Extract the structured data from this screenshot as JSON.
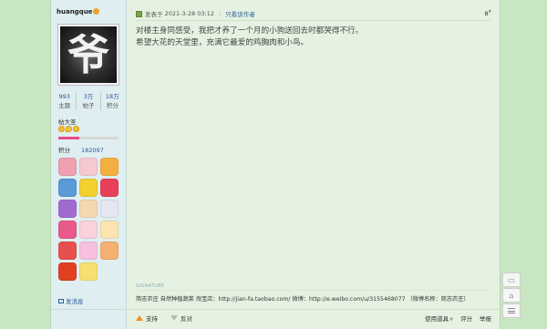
{
  "user": {
    "name": "huangque",
    "avatar_char": "爷",
    "stats": [
      {
        "value": "993",
        "label": "主题"
      },
      {
        "value": "3万",
        "label": "帖子"
      },
      {
        "value": "18万",
        "label": "积分"
      }
    ],
    "rank": "帖大圣",
    "level_progress": 0.35,
    "points_label": "积分",
    "points_value": "182097",
    "medals": [
      "#f0a0b0",
      "#f6c8d0",
      "#f3b040",
      "#5a9ad6",
      "#f2d030",
      "#e8405a",
      "#a06ad0",
      "#f4d9b0",
      "#e6e6f0",
      "#e85a8a",
      "#f9d2dc",
      "#fbe4b0",
      "#e85050",
      "#f7c0e0",
      "#f4b070",
      "#e04020",
      "#f8e070"
    ],
    "message_label": "发消息"
  },
  "post": {
    "posted_prefix": "发表于",
    "posted_time": "2021-3-28 03:12",
    "only_author": "只看该作者",
    "floor": "8",
    "floor_suffix": "#",
    "content_lines": [
      "对楼主身同感受，我把才养了一个月的小狗送回去时都哭得不行。",
      "希望大花的天堂里，充满它最爱的鸡胸肉和小鸟。"
    ],
    "signature_label": "SIGNATURE",
    "signature": "简志农庄 自然种植蔬菜 淘宝店：http://jian-fa.taobao.com/ 微博：http://e.weibo.com/u/3155468077 （微博名称：简志农庄）"
  },
  "actions": {
    "support": "支持",
    "oppose": "反对",
    "tools": "使用道具",
    "rate": "评分",
    "report": "举报"
  },
  "colors": {
    "page_bg": "#c9e6c2",
    "post_bg": "#e6f2e1",
    "sidebar_bg": "#dfeef0",
    "link": "#2a5a9a",
    "progress": "#e94a8a"
  }
}
